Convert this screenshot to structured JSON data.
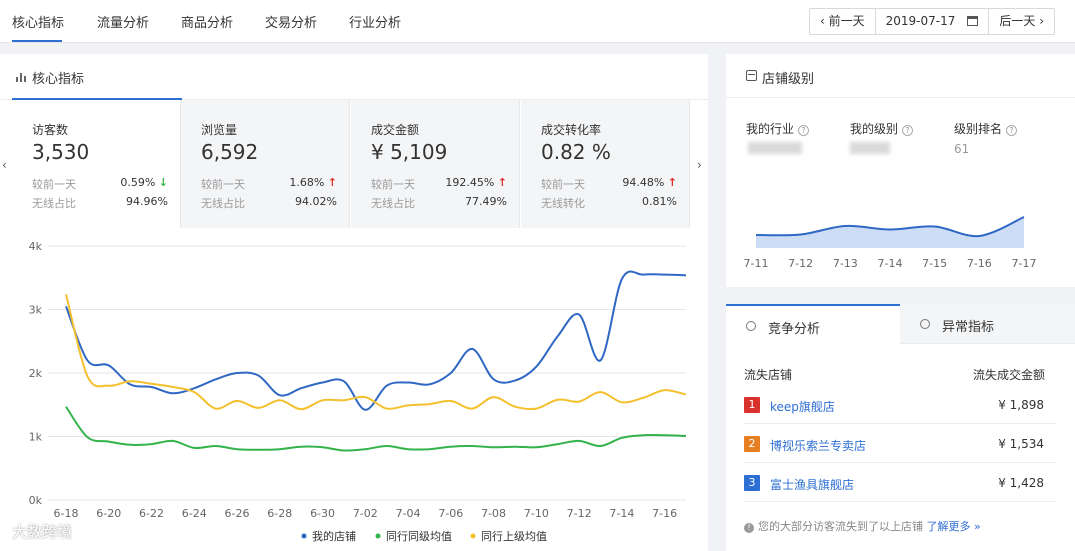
{
  "nav": {
    "tabs": [
      "核心指标",
      "流量分析",
      "商品分析",
      "交易分析",
      "行业分析"
    ],
    "prev_day": "‹ 前一天",
    "date": "2019-07-17",
    "next_day": "后一天 ›"
  },
  "core": {
    "title": "核心指标",
    "kpis": [
      {
        "label": "访客数",
        "value": "3,530",
        "row1_label": "较前一天",
        "row1_value": "0.59%",
        "row1_dir": "down",
        "row2_label": "无线占比",
        "row2_value": "94.96%"
      },
      {
        "label": "浏览量",
        "value": "6,592",
        "row1_label": "较前一天",
        "row1_value": "1.68%",
        "row1_dir": "up",
        "row2_label": "无线占比",
        "row2_value": "94.02%"
      },
      {
        "label": "成交金额",
        "value": "¥ 5,109",
        "row1_label": "较前一天",
        "row1_value": "192.45%",
        "row1_dir": "up",
        "row2_label": "无线占比",
        "row2_value": "77.49%"
      },
      {
        "label": "成交转化率",
        "value": "0.82 %",
        "row1_label": "较前一天",
        "row1_value": "94.48%",
        "row1_dir": "up",
        "row2_label": "无线转化",
        "row2_value": "0.81%"
      }
    ]
  },
  "chart_data": [
    {
      "type": "line",
      "x": [
        "6-18",
        "6-19",
        "6-20",
        "6-21",
        "6-22",
        "6-23",
        "6-24",
        "6-25",
        "6-26",
        "6-27",
        "6-28",
        "6-29",
        "6-30",
        "7-01",
        "7-02",
        "7-03",
        "7-04",
        "7-05",
        "7-06",
        "7-07",
        "7-08",
        "7-09",
        "7-10",
        "7-11",
        "7-12",
        "7-13",
        "7-14",
        "7-15",
        "7-16",
        "7-17"
      ],
      "x_tick_labels": [
        "6-18",
        "6-20",
        "6-22",
        "6-24",
        "6-26",
        "6-28",
        "6-30",
        "7-02",
        "7-04",
        "7-06",
        "7-08",
        "7-10",
        "7-12",
        "7-14",
        "7-16"
      ],
      "y_tick_labels": [
        "0k",
        "1k",
        "2k",
        "3k",
        "4k"
      ],
      "ylim": [
        0,
        4000
      ],
      "grid": true,
      "legend": "bottom",
      "series": [
        {
          "name": "我的店铺",
          "color": "#2f68c4",
          "values": [
            3050,
            2200,
            2120,
            1820,
            1780,
            1680,
            1760,
            1900,
            2000,
            1960,
            1650,
            1760,
            1850,
            1870,
            1420,
            1800,
            1850,
            1820,
            2000,
            2380,
            1900,
            1880,
            2100,
            2580,
            2920,
            2200,
            3480,
            3550,
            3550,
            3540
          ]
        },
        {
          "name": "同行同级均值",
          "color": "#34b34a",
          "values": [
            1470,
            990,
            920,
            870,
            880,
            930,
            820,
            850,
            800,
            790,
            800,
            840,
            830,
            780,
            800,
            850,
            800,
            800,
            840,
            850,
            830,
            840,
            830,
            880,
            930,
            850,
            980,
            1020,
            1020,
            1010
          ]
        },
        {
          "name": "同行上级均值",
          "color": "#f4c02e",
          "values": [
            3240,
            1950,
            1800,
            1870,
            1830,
            1780,
            1700,
            1440,
            1560,
            1450,
            1570,
            1430,
            1570,
            1570,
            1620,
            1440,
            1490,
            1510,
            1560,
            1440,
            1620,
            1470,
            1440,
            1580,
            1550,
            1700,
            1540,
            1610,
            1730,
            1660
          ]
        }
      ]
    },
    {
      "type": "area",
      "x": [
        "7-11",
        "7-12",
        "7-13",
        "7-14",
        "7-15",
        "7-16",
        "7-17"
      ],
      "x_tick_labels": [
        "7-11",
        "7-12",
        "7-13",
        "7-14",
        "7-15",
        "7-16",
        "7-17"
      ],
      "ylim": [
        0,
        10
      ],
      "series": [
        {
          "color": "#2f68c4",
          "values": [
            2.6,
            2.7,
            4.4,
            3.7,
            4.3,
            2.4,
            6.2
          ]
        }
      ]
    }
  ],
  "level": {
    "title": "店铺级别",
    "labels": [
      "我的行业",
      "我的级别",
      "级别排名"
    ],
    "rank_value": "61"
  },
  "competition": {
    "tab_active": "竞争分析",
    "tab_other": "异常指标",
    "col_shop": "流失店铺",
    "col_amount": "流失成交金额",
    "rows": [
      {
        "rank": "1",
        "name": "keep旗舰店",
        "amount": "¥ 1,898",
        "color": "#d9312b"
      },
      {
        "rank": "2",
        "name": "博视乐索兰专卖店",
        "amount": "¥ 1,534",
        "color": "#e67e22"
      },
      {
        "rank": "3",
        "name": "富士渔具旗舰店",
        "amount": "¥ 1,428",
        "color": "#2e6fd3"
      }
    ],
    "tip": "您的大部分访客流失到了以上店铺",
    "tip_link": "了解更多 »"
  },
  "watermark": {
    "corner_text": "大数跨境"
  }
}
